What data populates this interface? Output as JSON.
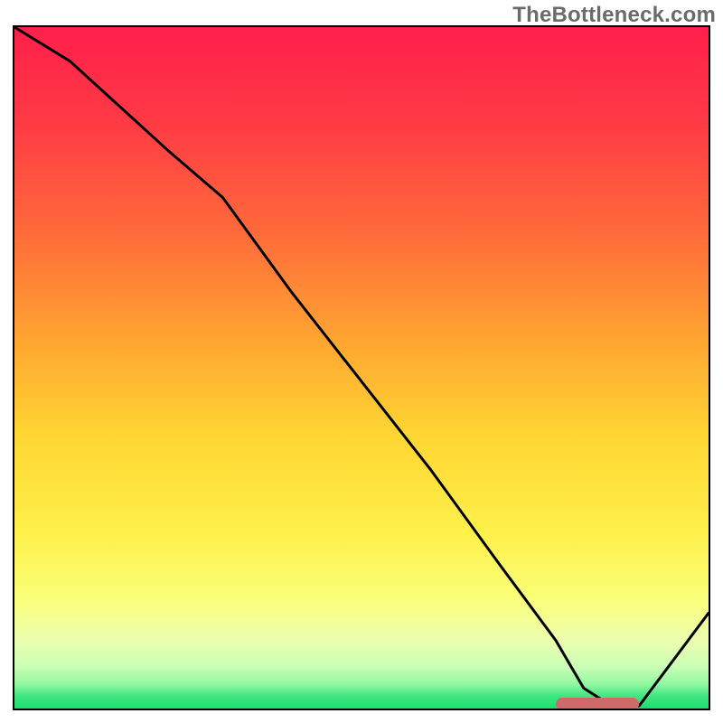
{
  "watermark": "TheBottleneck.com",
  "chart_data": {
    "type": "line",
    "title": "",
    "xlabel": "",
    "ylabel": "",
    "xlim": [
      0,
      100
    ],
    "ylim": [
      0,
      100
    ],
    "x": [
      0,
      8,
      22,
      30,
      40,
      50,
      60,
      70,
      78,
      82,
      86,
      90,
      100
    ],
    "values": [
      100,
      95,
      82,
      75,
      61,
      48,
      35,
      21,
      10,
      3,
      0.4,
      0.4,
      14
    ],
    "optimal_range": {
      "start": 78,
      "end": 90,
      "y": 0.6
    },
    "gradient_stops": [
      {
        "offset": 0,
        "color": "#ff1f4b"
      },
      {
        "offset": 14,
        "color": "#ff3a45"
      },
      {
        "offset": 30,
        "color": "#ff6a3a"
      },
      {
        "offset": 46,
        "color": "#ffa531"
      },
      {
        "offset": 60,
        "color": "#ffd633"
      },
      {
        "offset": 74,
        "color": "#fff04a"
      },
      {
        "offset": 84,
        "color": "#fbff7a"
      },
      {
        "offset": 90,
        "color": "#ecffb0"
      },
      {
        "offset": 94,
        "color": "#c8ffb4"
      },
      {
        "offset": 96.5,
        "color": "#90f7a0"
      },
      {
        "offset": 98,
        "color": "#46e884"
      },
      {
        "offset": 100,
        "color": "#18df6e"
      }
    ]
  }
}
